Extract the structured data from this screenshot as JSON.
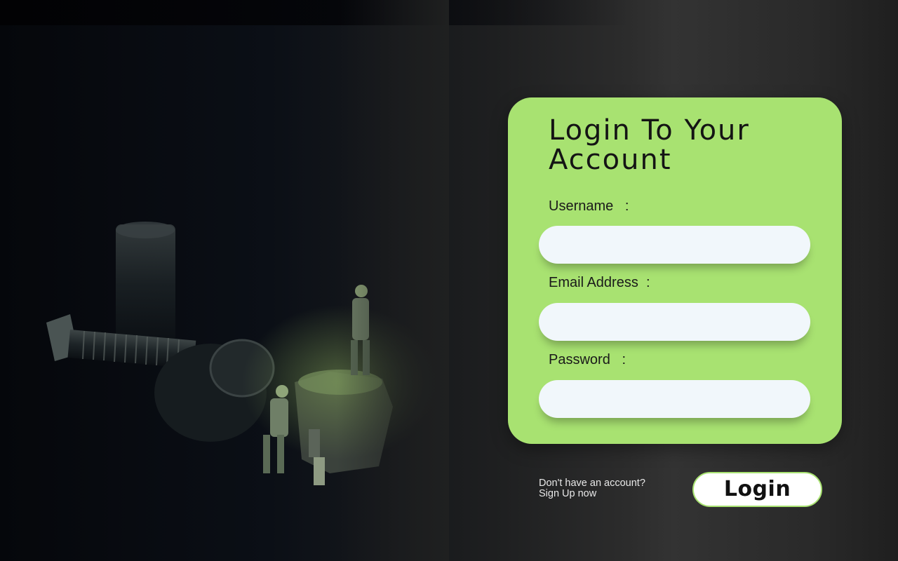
{
  "login_card": {
    "title": "Login To Your Account",
    "fields": [
      {
        "label": "Username   :",
        "value": ""
      },
      {
        "label": "Email Address  :",
        "value": ""
      },
      {
        "label": "Password   :",
        "value": ""
      }
    ]
  },
  "footer": {
    "signup_line1": "Don't have an account?",
    "signup_line2": "Sign Up now",
    "login_button": "Login"
  },
  "colors": {
    "card_background": "#a8e271",
    "input_background": "#f1f7fb",
    "button_border": "#a8e271",
    "page_background": "#2c2c2c"
  },
  "background_image": {
    "subject": "miniature-workers-with-bolts-and-nut-photo"
  }
}
